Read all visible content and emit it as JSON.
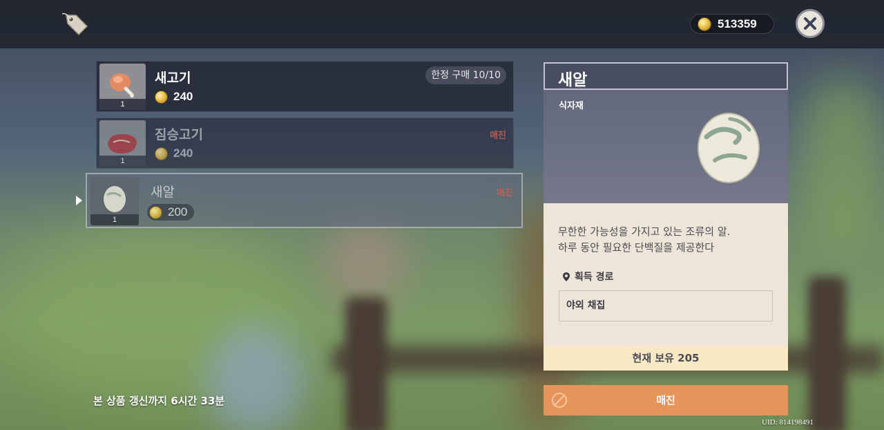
{
  "topbar": {
    "currency_value": "513359",
    "icons": {
      "shop": "price-tag-icon",
      "currency": "mora-coin-icon",
      "close": "close-icon"
    }
  },
  "items": [
    {
      "name": "새고기",
      "price": "240",
      "count": "1",
      "limit": "한정 구매 10/10",
      "status": "",
      "icon": "chicken-drumstick-icon"
    },
    {
      "name": "짐승고기",
      "price": "240",
      "count": "1",
      "limit": "",
      "status": "매진",
      "icon": "raw-meat-icon"
    },
    {
      "name": "새알",
      "price": "200",
      "count": "1",
      "limit": "",
      "status": "매진",
      "icon": "bird-egg-icon",
      "selected": true
    }
  ],
  "refresh_text": "본 상품 갱신까지 6시간 33분",
  "detail": {
    "title": "새알",
    "category": "식자재",
    "description_line1": "무한한 가능성을 가지고 있는 조류의 알.",
    "description_line2": "하루 동안 필요한 단백질을 제공한다",
    "source_title": "획득 경로",
    "source_value": "야외 채집",
    "owned": "현재 보유 205",
    "buy_label": "매진"
  },
  "uid": "UID: 814198491",
  "colors": {
    "soldout": "#e0574b",
    "buy_button": "#e6955a",
    "panel_body": "#ece5d8",
    "owned_bar": "#f6e9c4"
  }
}
